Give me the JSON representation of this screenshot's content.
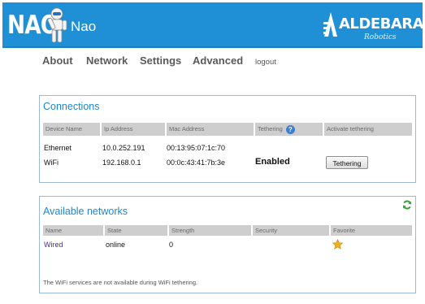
{
  "header": {
    "logo_text": "NAO",
    "title": "Nao",
    "brand_name": "ALDEBARAN",
    "brand_sub": "Robotics"
  },
  "nav": {
    "about": "About",
    "network": "Network",
    "settings": "Settings",
    "advanced": "Advanced",
    "logout": "logout"
  },
  "connections": {
    "title": "Connections",
    "columns": [
      "Device Name",
      "Ip Address",
      "Mac Address",
      "Tethering",
      "Activate tethering"
    ],
    "rows": [
      {
        "device": "Ethernet",
        "ip": "10.0.252.191",
        "mac": "00:13:95:07:1c:70",
        "tethering": "",
        "action": ""
      },
      {
        "device": "WiFi",
        "ip": "192.168.0.1",
        "mac": "00:0c:43:41:7b:3e",
        "tethering": "Enabled",
        "action": "Tethering"
      }
    ],
    "help_icon": "help-icon"
  },
  "networks": {
    "title": "Available networks",
    "columns": [
      "Name",
      "State",
      "Strength",
      "Security",
      "Favorite"
    ],
    "rows": [
      {
        "name": "Wired",
        "state": "online",
        "strength": "0",
        "security": "",
        "favorite": "star-icon"
      }
    ],
    "note": "The WiFi services are not available during WiFi tethering.",
    "refresh_icon": "refresh-icon"
  },
  "colors": {
    "header_blue": "#1f8fd6",
    "title_blue": "#1f86c9",
    "header_cell_gray": "#cecece",
    "link_purple": "#3a2fa8",
    "refresh_green": "#3aa13a",
    "star_gold": "#f2b01e"
  }
}
